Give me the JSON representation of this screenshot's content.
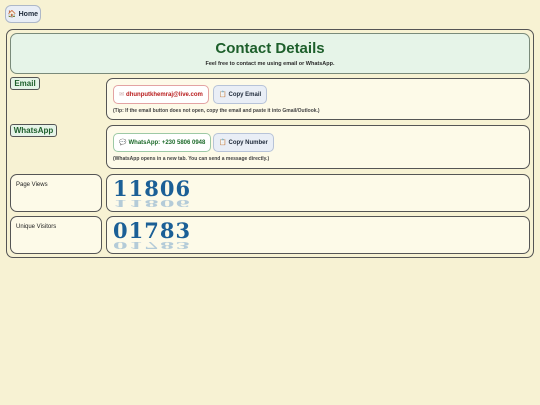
{
  "nav": {
    "home_icon": "home-icon",
    "home_label": "Home"
  },
  "header": {
    "title": "Contact Details",
    "subtitle": "Feel free to contact me using email or WhatsApp."
  },
  "email": {
    "section_label": "Email",
    "address": "dhunputkhemraj@live.com",
    "address_icon": "envelope-icon",
    "copy_label": "Copy Email",
    "copy_icon": "clipboard-icon",
    "tip": "(Tip: If the email button does not open, copy the email and paste it into Gmail/Outlook.)"
  },
  "whatsapp": {
    "section_label": "WhatsApp",
    "label": "WhatsApp: +230 5806 0948",
    "label_icon": "chat-icon",
    "copy_label": "Copy Number",
    "copy_icon": "clipboard-icon",
    "note": "(WhatsApp opens in a new tab. You can send a message directly.)"
  },
  "stats": {
    "page_views_label": "Page Views",
    "page_views_value": "11806",
    "unique_visitors_label": "Unique Visitors",
    "unique_visitors_value": "01783"
  },
  "colors": {
    "background": "#f7f2d3",
    "title_green": "#1d5f2b",
    "email_red": "#b81b1b",
    "counter_blue": "#1b5f96"
  }
}
